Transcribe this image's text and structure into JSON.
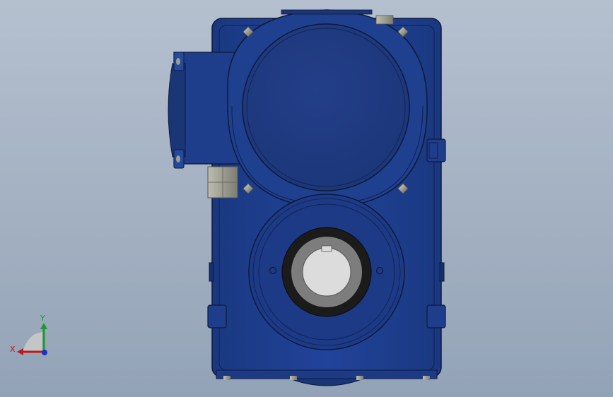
{
  "viewport": {
    "background_top": "#b5c0cf",
    "background_bottom": "#93a3b7"
  },
  "model": {
    "body_color": "#1f3f8f",
    "body_dark": "#152d6b",
    "body_light": "#2c52a8",
    "bore_ring_color": "#1a1a1a",
    "bore_inner_color": "#8a8a8a",
    "bolt_color": "#9a9a8a"
  },
  "triad": {
    "x_label": "X",
    "y_label": "Y",
    "x_color": "#c01818",
    "y_color": "#1a9a2a",
    "z_color": "#2030c0"
  }
}
